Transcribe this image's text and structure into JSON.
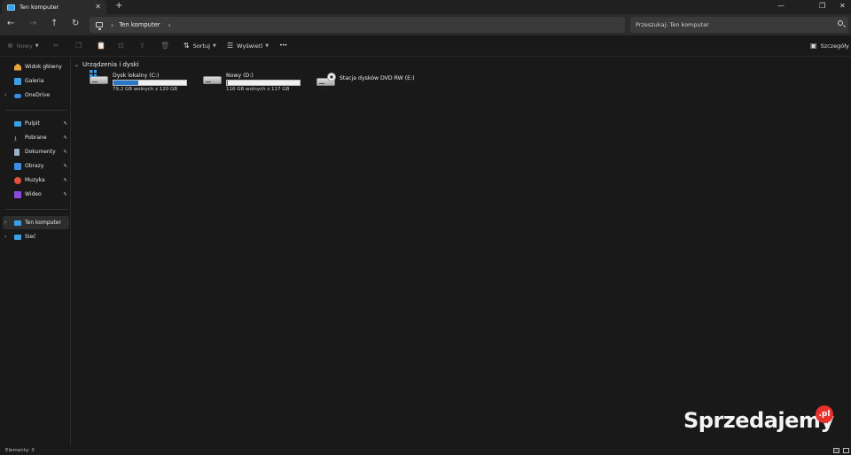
{
  "window": {
    "tab_title": "Ten komputer",
    "new_tab_symbol": "+",
    "tab_close_symbol": "✕",
    "minimize_symbol": "—",
    "maximize_symbol": "❐",
    "close_symbol": "✕"
  },
  "navigation": {
    "back_symbol": "←",
    "forward_symbol": "→",
    "up_symbol": "↑",
    "refresh_symbol": "↻",
    "chevron_symbol": "›",
    "breadcrumb": "Ten komputer",
    "search_placeholder": "Przeszukaj: Ten komputer"
  },
  "toolbar": {
    "new_label": "Nowy",
    "sort_label": "Sortuj",
    "view_label": "Wyświetl",
    "more_symbol": "•••",
    "details_label": "Szczegóły"
  },
  "sidebar": {
    "items": [
      {
        "label": "Widok główny",
        "icon": "home-icon",
        "color": "#e8a33a"
      },
      {
        "label": "Galeria",
        "icon": "gallery-icon",
        "color": "#3aa0e6"
      },
      {
        "label": "OneDrive",
        "icon": "onedrive-icon",
        "color": "#3a8ee6",
        "expandable": true
      },
      {
        "label": "Pulpit",
        "icon": "desktop-icon",
        "color": "#3aa0e6",
        "pinned": true
      },
      {
        "label": "Pobrane",
        "icon": "downloads-icon",
        "color": "#3ac07a",
        "pinned": true
      },
      {
        "label": "Dokumenty",
        "icon": "documents-icon",
        "color": "#9ab0c8",
        "pinned": true
      },
      {
        "label": "Obrazy",
        "icon": "pictures-icon",
        "color": "#3a8ee6",
        "pinned": true
      },
      {
        "label": "Muzyka",
        "icon": "music-icon",
        "color": "#e0503a",
        "pinned": true
      },
      {
        "label": "Wideo",
        "icon": "videos-icon",
        "color": "#8a4ae0",
        "pinned": true
      },
      {
        "label": "Ten komputer",
        "icon": "this-pc-icon",
        "color": "#3aa0e6",
        "expandable": true,
        "selected": true
      },
      {
        "label": "Sieć",
        "icon": "network-icon",
        "color": "#3aa0e6",
        "expandable": true
      }
    ],
    "pin_symbol": "📌"
  },
  "content": {
    "section_title": "Urządzenia i dyski",
    "drives": [
      {
        "name": "Dysk lokalny (C:)",
        "free_text": "79,2 GB wolnych z 120 GB",
        "used_fraction": 0.34,
        "icon": "system-drive-icon"
      },
      {
        "name": "Nowy (D:)",
        "free_text": "116 GB wolnych z 117 GB",
        "used_fraction": 0.01,
        "icon": "drive-icon"
      },
      {
        "name": "Stacja dysków DVD RW (E:)",
        "icon": "dvd-drive-icon",
        "badge": "DVD"
      }
    ]
  },
  "statusbar": {
    "text": "Elementy: 3"
  },
  "watermark": {
    "text": "Sprzedajemy",
    "badge": ".pl"
  },
  "colors": {
    "accent": "#2a78c8",
    "background": "#191919",
    "watermark_badge": "#e8302c"
  }
}
